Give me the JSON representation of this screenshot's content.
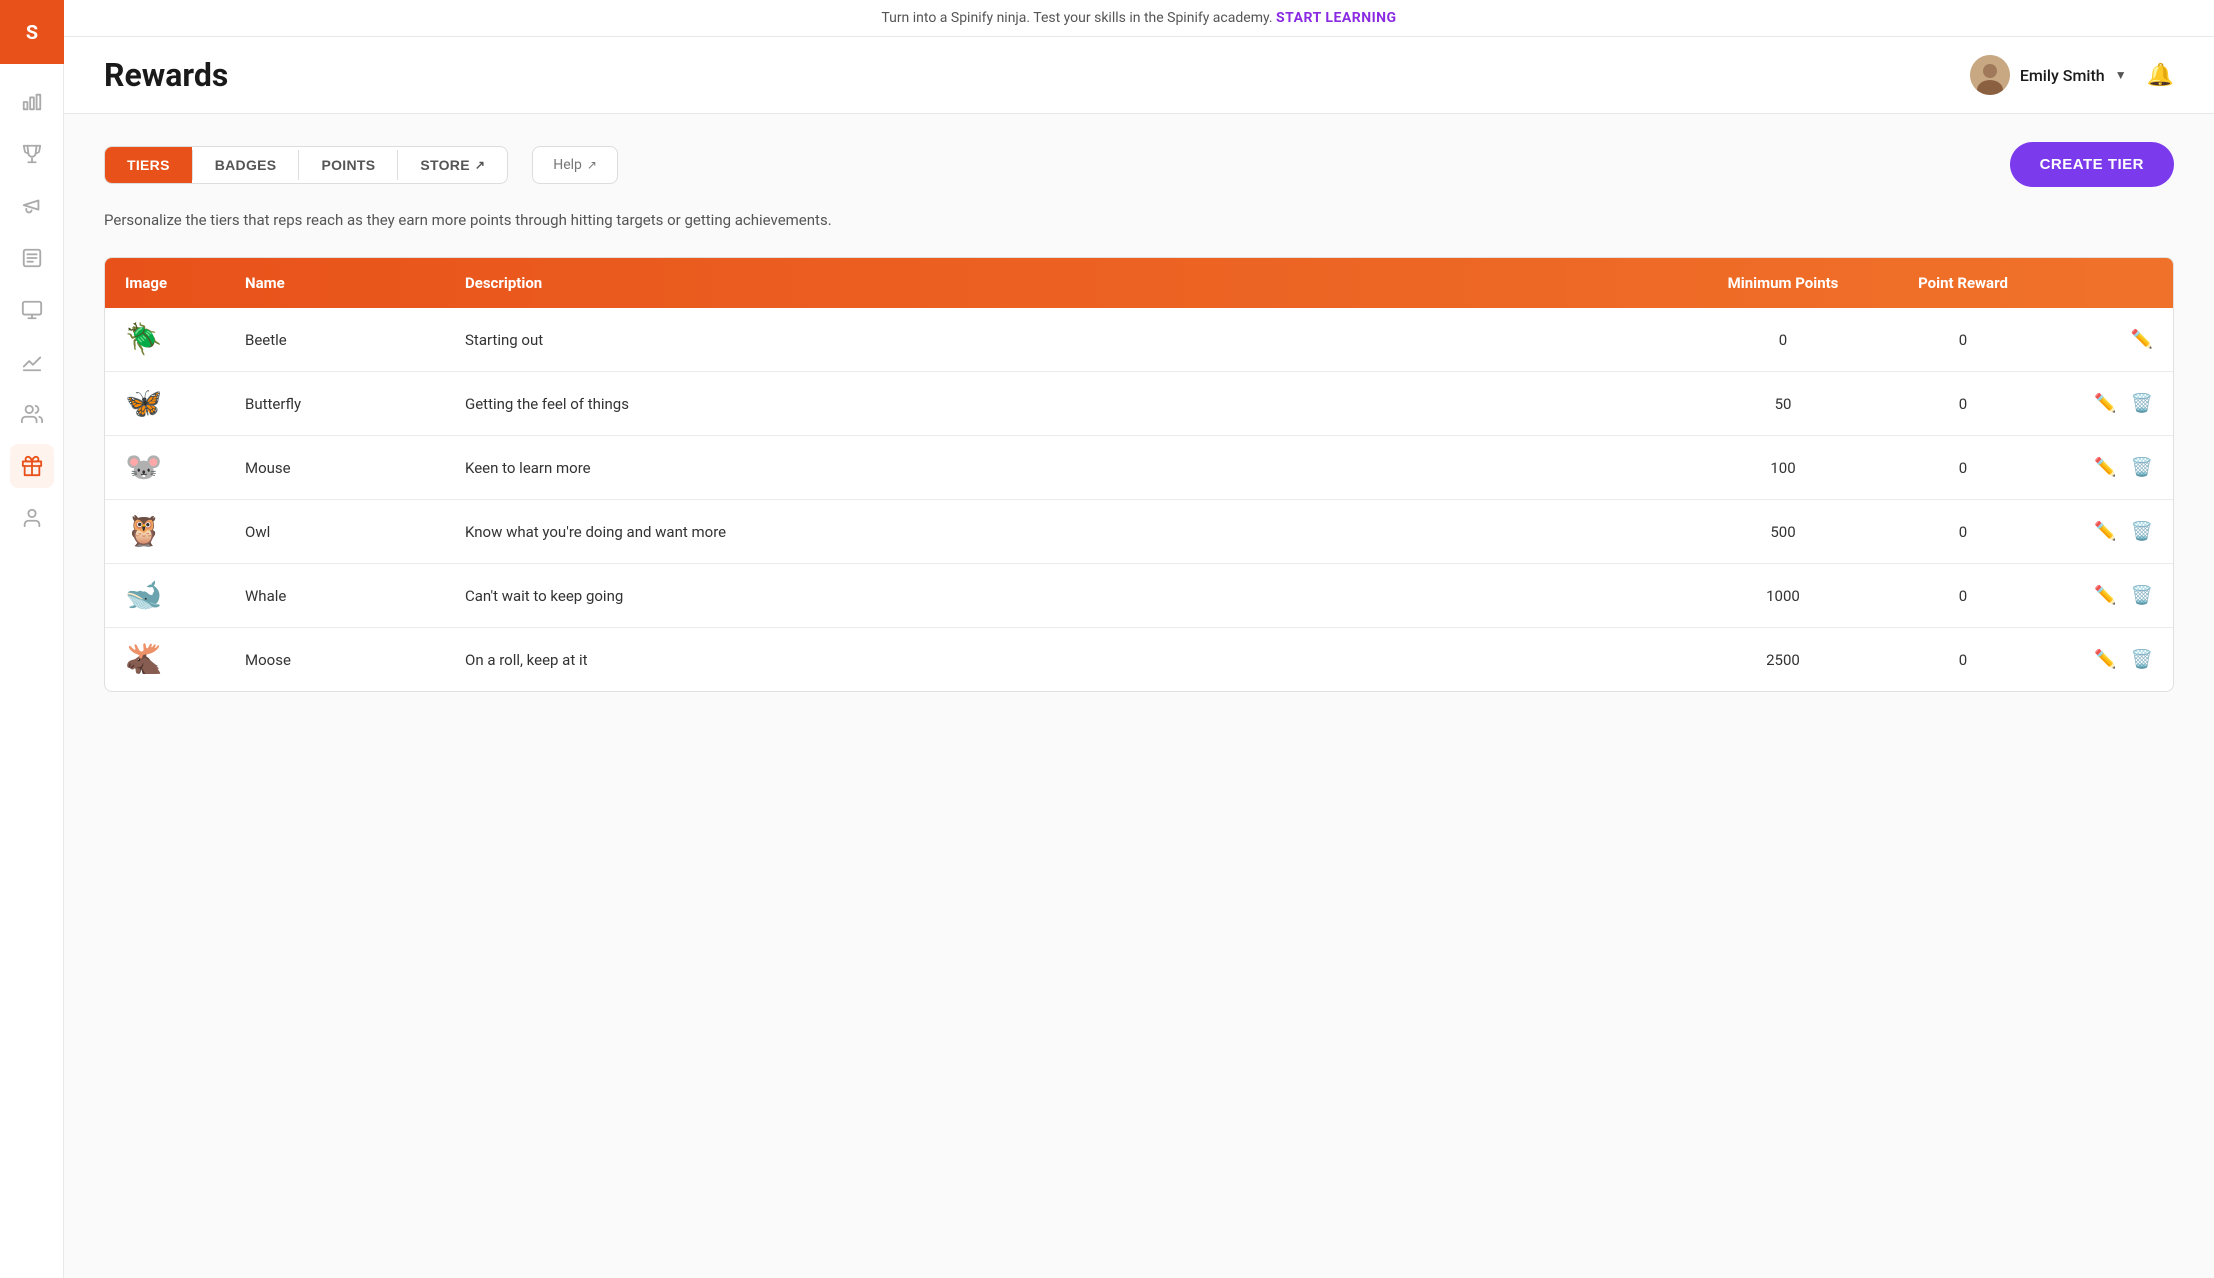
{
  "app": {
    "logo_alt": "Spinify Logo"
  },
  "banner": {
    "text": "Turn into a Spinify ninja. Test your skills in the Spinify academy.",
    "link_text": "START LEARNING"
  },
  "header": {
    "title": "Rewards",
    "user": {
      "name": "Emily Smith",
      "avatar_emoji": "👩"
    }
  },
  "tabs": {
    "items": [
      {
        "label": "TIERS",
        "active": true
      },
      {
        "label": "BADGES",
        "active": false
      },
      {
        "label": "POINTS",
        "active": false
      },
      {
        "label": "STORE",
        "active": false,
        "has_icon": true
      }
    ],
    "help_label": "Help",
    "create_tier_label": "CREATE TIER"
  },
  "description": "Personalize the tiers that reps reach as they earn more points through hitting targets or getting achievements.",
  "table": {
    "columns": [
      "Image",
      "Name",
      "Description",
      "Minimum Points",
      "Point Reward",
      ""
    ],
    "rows": [
      {
        "emoji": "🪲",
        "name": "Beetle",
        "description": "Starting out",
        "min_points": "0",
        "point_reward": "0",
        "can_delete": false
      },
      {
        "emoji": "🦋",
        "name": "Butterfly",
        "description": "Getting the feel of things",
        "min_points": "50",
        "point_reward": "0",
        "can_delete": true
      },
      {
        "emoji": "🐭",
        "name": "Mouse",
        "description": "Keen to learn more",
        "min_points": "100",
        "point_reward": "0",
        "can_delete": true
      },
      {
        "emoji": "🦉",
        "name": "Owl",
        "description": "Know what you're doing and want more",
        "min_points": "500",
        "point_reward": "0",
        "can_delete": true
      },
      {
        "emoji": "🐋",
        "name": "Whale",
        "description": "Can't wait to keep going",
        "min_points": "1000",
        "point_reward": "0",
        "can_delete": true
      },
      {
        "emoji": "🫎",
        "name": "Moose",
        "description": "On a roll, keep at it",
        "min_points": "2500",
        "point_reward": "0",
        "can_delete": true
      }
    ]
  },
  "sidebar": {
    "items": [
      {
        "icon": "bar-chart-icon",
        "label": "Analytics"
      },
      {
        "icon": "trophy-icon",
        "label": "Achievements"
      },
      {
        "icon": "megaphone-icon",
        "label": "Campaigns"
      },
      {
        "icon": "list-icon",
        "label": "Reports"
      },
      {
        "icon": "monitor-icon",
        "label": "TV"
      },
      {
        "icon": "chart-line-icon",
        "label": "Performance"
      },
      {
        "icon": "people-icon",
        "label": "Team"
      },
      {
        "icon": "gift-icon",
        "label": "Rewards",
        "active": true
      },
      {
        "icon": "user-icon",
        "label": "Users"
      }
    ]
  }
}
